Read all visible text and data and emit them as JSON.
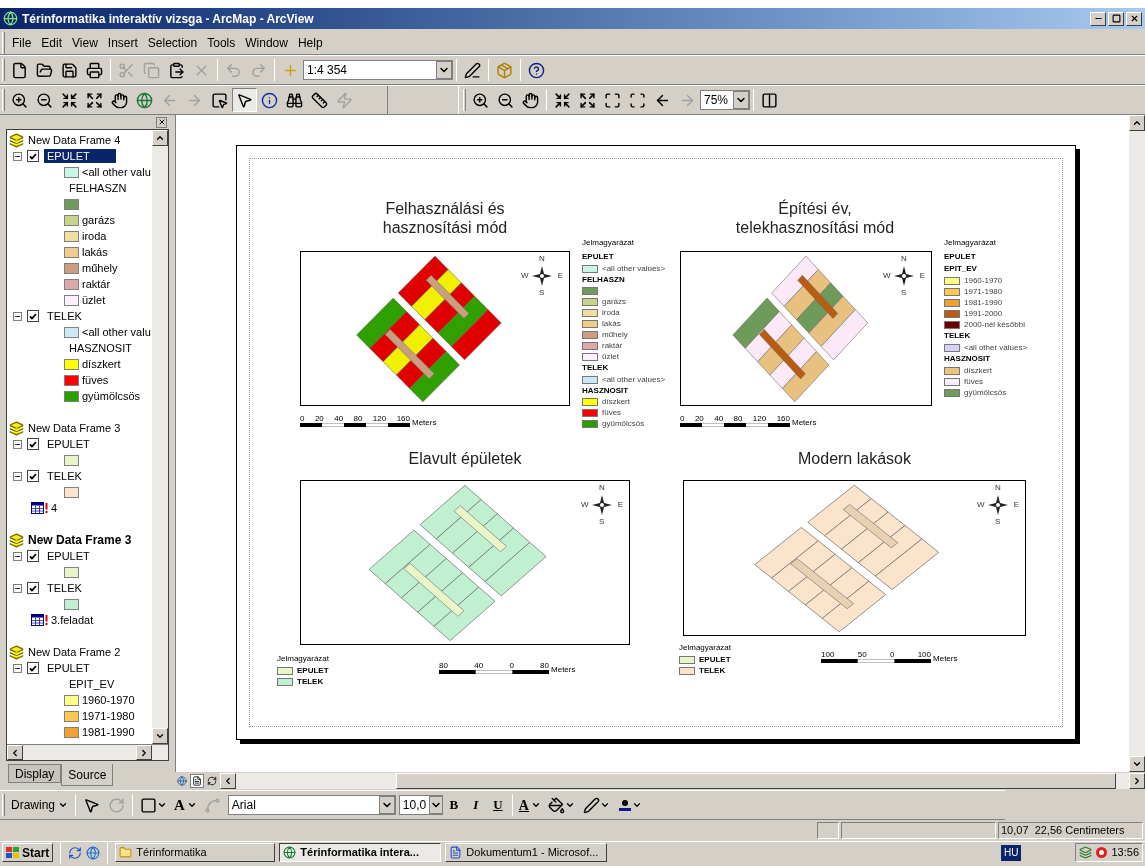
{
  "window": {
    "title": "Térinformatika interaktív vizsga - ArcMap - ArcView"
  },
  "menu": [
    "File",
    "Edit",
    "View",
    "Insert",
    "Selection",
    "Tools",
    "Window",
    "Help"
  ],
  "standard_toolbar": [
    {
      "kind": "new",
      "disabled": false
    },
    {
      "kind": "open",
      "disabled": false
    },
    {
      "kind": "save",
      "disabled": false
    },
    {
      "kind": "print",
      "disabled": false
    },
    {
      "kind": "sep"
    },
    {
      "kind": "cut",
      "disabled": true
    },
    {
      "kind": "copy",
      "disabled": true
    },
    {
      "kind": "paste",
      "disabled": false
    },
    {
      "kind": "delete",
      "disabled": true
    },
    {
      "kind": "sep"
    },
    {
      "kind": "undo",
      "disabled": true
    },
    {
      "kind": "redo",
      "disabled": true
    },
    {
      "kind": "sep"
    },
    {
      "kind": "add-data",
      "disabled": false
    },
    {
      "kind": "combo",
      "value": "1:4 354"
    },
    {
      "kind": "sep"
    },
    {
      "kind": "editor",
      "disabled": false
    },
    {
      "kind": "sep"
    },
    {
      "kind": "toolbox",
      "disabled": false
    },
    {
      "kind": "sep"
    },
    {
      "kind": "whats-this",
      "disabled": false
    }
  ],
  "tools_toolbar": [
    {
      "kind": "zoom-in",
      "disabled": false,
      "selected": false
    },
    {
      "kind": "zoom-out",
      "disabled": false,
      "selected": false
    },
    {
      "kind": "fixed-zoom-in",
      "disabled": false,
      "selected": false
    },
    {
      "kind": "fixed-zoom-out",
      "disabled": false,
      "selected": false
    },
    {
      "kind": "pan",
      "disabled": false,
      "selected": false
    },
    {
      "kind": "full-extent",
      "disabled": false,
      "selected": false
    },
    {
      "kind": "back",
      "disabled": true,
      "selected": false
    },
    {
      "kind": "forward",
      "disabled": true,
      "selected": false
    },
    {
      "kind": "select-features",
      "disabled": false,
      "selected": false
    },
    {
      "kind": "select-elements",
      "disabled": false,
      "selected": true
    },
    {
      "kind": "identify",
      "disabled": false,
      "selected": false
    },
    {
      "kind": "find",
      "disabled": false,
      "selected": false
    },
    {
      "kind": "measure",
      "disabled": false,
      "selected": false
    },
    {
      "kind": "hyperlink",
      "disabled": true,
      "selected": false
    }
  ],
  "layout_toolbar": [
    {
      "kind": "zoom-in",
      "disabled": false
    },
    {
      "kind": "zoom-out",
      "disabled": false
    },
    {
      "kind": "pan",
      "disabled": false
    },
    {
      "kind": "sep"
    },
    {
      "kind": "fixed-zoom-in",
      "disabled": false
    },
    {
      "kind": "fixed-zoom-out",
      "disabled": false
    },
    {
      "kind": "whole-page",
      "disabled": false
    },
    {
      "kind": "actual-size",
      "disabled": false
    },
    {
      "kind": "back",
      "disabled": false
    },
    {
      "kind": "forward",
      "disabled": true
    },
    {
      "kind": "combo",
      "value": "75%"
    },
    {
      "kind": "sep"
    },
    {
      "kind": "draft",
      "disabled": false
    }
  ],
  "toc": {
    "frames": [
      {
        "name": "New Data Frame 4",
        "active": false,
        "children": [
          {
            "kind": "layer",
            "name": "EPULET",
            "checked": true,
            "expanded": true,
            "selected": true,
            "children": [
              {
                "kind": "swatch",
                "label": "<all other valu",
                "color": "#c8f5e6"
              },
              {
                "kind": "heading",
                "label": "FELHASZN"
              },
              {
                "kind": "swatch",
                "color": "#6e9a5a"
              },
              {
                "kind": "swatch",
                "label": "garázs",
                "color": "#c8d48c"
              },
              {
                "kind": "swatch",
                "label": "iroda",
                "color": "#f0e0a0"
              },
              {
                "kind": "swatch",
                "label": "lakás",
                "color": "#f0cc8c"
              },
              {
                "kind": "swatch",
                "label": "műhely",
                "color": "#d09c80"
              },
              {
                "kind": "swatch",
                "label": "raktár",
                "color": "#dca8a8"
              },
              {
                "kind": "swatch",
                "label": "üzlet",
                "color": "#fcf0fc"
              }
            ]
          },
          {
            "kind": "layer",
            "name": "TELEK",
            "checked": true,
            "expanded": true,
            "selected": false,
            "children": [
              {
                "kind": "swatch",
                "label": "<all other valu",
                "color": "#cce8f4"
              },
              {
                "kind": "heading",
                "label": "HASZNOSIT"
              },
              {
                "kind": "swatch",
                "label": "díszkert",
                "color": "#ffff00"
              },
              {
                "kind": "swatch",
                "label": "füves",
                "color": "#ff0000"
              },
              {
                "kind": "swatch",
                "label": "gyümölcsös",
                "color": "#28a000"
              }
            ]
          }
        ]
      },
      {
        "name": "New Data Frame 3",
        "active": false,
        "children": [
          {
            "kind": "layer",
            "name": "EPULET",
            "checked": true,
            "expanded": true,
            "selected": false,
            "children": [
              {
                "kind": "swatch",
                "color": "#e8f5c8"
              }
            ]
          },
          {
            "kind": "layer",
            "name": "TELEK",
            "checked": true,
            "expanded": true,
            "selected": false,
            "children": [
              {
                "kind": "swatch",
                "color": "#fbe3cc"
              }
            ]
          },
          {
            "kind": "table",
            "name": "4"
          }
        ]
      },
      {
        "name": "New Data Frame 3",
        "active": true,
        "children": [
          {
            "kind": "layer",
            "name": "EPULET",
            "checked": true,
            "expanded": true,
            "selected": false,
            "children": [
              {
                "kind": "swatch",
                "color": "#e8f5c8"
              }
            ]
          },
          {
            "kind": "layer",
            "name": "TELEK",
            "checked": true,
            "expanded": true,
            "selected": false,
            "children": [
              {
                "kind": "swatch",
                "color": "#c0f0d0"
              }
            ]
          },
          {
            "kind": "table",
            "name": "3.feladat"
          }
        ]
      },
      {
        "name": "New Data Frame 2",
        "active": false,
        "children": [
          {
            "kind": "layer",
            "name": "EPULET",
            "checked": true,
            "expanded": true,
            "selected": false,
            "children": [
              {
                "kind": "heading",
                "label": "EPIT_EV"
              },
              {
                "kind": "swatch",
                "label": "1960-1970",
                "color": "#ffff88"
              },
              {
                "kind": "swatch",
                "label": "1971-1980",
                "color": "#fcc850"
              },
              {
                "kind": "swatch",
                "label": "1981-1990",
                "color": "#f0a030"
              }
            ]
          }
        ]
      }
    ],
    "tabs": [
      {
        "label": "Display",
        "selected": false
      },
      {
        "label": "Source",
        "selected": true
      }
    ]
  },
  "layout": {
    "panels": [
      {
        "kind": "top",
        "title": [
          "Felhasználási és",
          "hasznosítási mód"
        ],
        "compass": [
          "N",
          "W",
          "E",
          "S"
        ],
        "legend": [
          {
            "kind": "title",
            "label": "Jelmagyarázat"
          },
          {
            "kind": "group",
            "label": "EPULET"
          },
          {
            "kind": "swatch",
            "label": "<all other values>",
            "color": "#c8f5e6"
          },
          {
            "kind": "field",
            "label": "FELHASZN"
          },
          {
            "kind": "swatch",
            "color": "#6e9a5a"
          },
          {
            "kind": "swatch",
            "label": "garázs",
            "color": "#c8d48c"
          },
          {
            "kind": "swatch",
            "label": "iroda",
            "color": "#f0e0a0"
          },
          {
            "kind": "swatch",
            "label": "lakás",
            "color": "#f0cc8c"
          },
          {
            "kind": "swatch",
            "label": "műhely",
            "color": "#d09c80"
          },
          {
            "kind": "swatch",
            "label": "raktár",
            "color": "#dca8a8"
          },
          {
            "kind": "swatch",
            "label": "üzlet",
            "color": "#fcf0fc"
          },
          {
            "kind": "group",
            "label": "TELEK"
          },
          {
            "kind": "swatch",
            "label": "<all other values>",
            "color": "#cce8f4"
          },
          {
            "kind": "field",
            "label": "HASZNOSIT"
          },
          {
            "kind": "swatch",
            "label": "díszkert",
            "color": "#ffff00"
          },
          {
            "kind": "swatch",
            "label": "füves",
            "color": "#ff0000"
          },
          {
            "kind": "swatch",
            "label": "gyümölcsös",
            "color": "#28a000"
          }
        ],
        "scale": {
          "ticks": [
            "0",
            "20",
            "40",
            "80",
            "120",
            "160"
          ],
          "unit": "Meters"
        }
      },
      {
        "kind": "top",
        "title": [
          "Építési év,",
          "telekhasznosítási mód"
        ],
        "compass": [
          "N",
          "W",
          "E",
          "S"
        ],
        "legend": [
          {
            "kind": "title",
            "label": "Jelmagyarázat"
          },
          {
            "kind": "group",
            "label": "EPULET"
          },
          {
            "kind": "group",
            "label": "EPIT_EV"
          },
          {
            "kind": "swatch",
            "label": "1960-1970",
            "color": "#ffff80"
          },
          {
            "kind": "swatch",
            "label": "1971-1980",
            "color": "#fcc850"
          },
          {
            "kind": "swatch",
            "label": "1981-1990",
            "color": "#f0a030"
          },
          {
            "kind": "swatch",
            "label": "1991-2000",
            "color": "#b85c14"
          },
          {
            "kind": "swatch",
            "label": "2000-nél későbbi",
            "color": "#6a0000"
          },
          {
            "kind": "group",
            "label": "TELEK"
          },
          {
            "kind": "swatch",
            "label": "<all other values>",
            "color": "#d8d0f4"
          },
          {
            "kind": "group",
            "label": "HASZNOSIT"
          },
          {
            "kind": "swatch",
            "label": "díszkert",
            "color": "#ecc47c"
          },
          {
            "kind": "swatch",
            "label": "füves",
            "color": "#fcecfc"
          },
          {
            "kind": "swatch",
            "label": "gyümölcsös",
            "color": "#6e9a5a"
          }
        ],
        "scale": {
          "ticks": [
            "0",
            "20",
            "40",
            "80",
            "120",
            "160"
          ],
          "unit": "Meters"
        }
      },
      {
        "kind": "bottom",
        "title": [
          "Elavult épületek"
        ],
        "compass": [
          "N",
          "W",
          "E",
          "S"
        ],
        "legend": [
          {
            "kind": "title",
            "label": "Jelmagyarázat"
          },
          {
            "kind": "swatch",
            "label": "EPULET",
            "color": "#e8f5c8"
          },
          {
            "kind": "swatch",
            "label": "TELEK",
            "color": "#c0f0d0"
          }
        ],
        "scale": {
          "ticks": [
            "80",
            "40",
            "0",
            "80"
          ],
          "unit": "Meters"
        }
      },
      {
        "kind": "bottom",
        "title": [
          "Modern lakások"
        ],
        "compass": [
          "N",
          "W",
          "E",
          "S"
        ],
        "legend": [
          {
            "kind": "title",
            "label": "Jelmagyarázat"
          },
          {
            "kind": "swatch",
            "label": "EPULET",
            "color": "#e8f5c8"
          },
          {
            "kind": "swatch",
            "label": "TELEK",
            "color": "#fbe3cc"
          }
        ],
        "scale": {
          "ticks": [
            "100",
            "50",
            "0",
            "100"
          ],
          "unit": "Meters"
        }
      }
    ]
  },
  "drawing_toolbar": [
    {
      "kind": "menu",
      "label": "Drawing"
    },
    {
      "kind": "sep"
    },
    {
      "kind": "pointer",
      "disabled": false
    },
    {
      "kind": "rotate",
      "disabled": true
    },
    {
      "kind": "sep"
    },
    {
      "kind": "rectangle",
      "disabled": false
    },
    {
      "kind": "text",
      "label": "A"
    },
    {
      "kind": "vertices",
      "disabled": true
    },
    {
      "kind": "font",
      "value": "Arial"
    },
    {
      "kind": "size",
      "value": "10,0"
    },
    {
      "kind": "style",
      "label": "B"
    },
    {
      "kind": "style",
      "label": "I"
    },
    {
      "kind": "style",
      "label": "U"
    },
    {
      "kind": "sep"
    },
    {
      "kind": "font-color",
      "label": "A"
    },
    {
      "kind": "fill-color",
      "disabled": false
    },
    {
      "kind": "line-color",
      "disabled": false
    },
    {
      "kind": "marker-color",
      "disabled": false
    }
  ],
  "status_bar": {
    "coordinates": "10,07  22,56 Centimeters"
  },
  "taskbar": {
    "start": "Start",
    "tasks": [
      {
        "label": "Térinformatika",
        "selected": false,
        "kind": "folder"
      },
      {
        "label": "Térinformatika intera...",
        "selected": true,
        "kind": "arcmap"
      },
      {
        "label": "Dokumentum1 - Microsof...",
        "selected": false,
        "kind": "word"
      }
    ],
    "language": "HU",
    "clock": "13:56"
  }
}
